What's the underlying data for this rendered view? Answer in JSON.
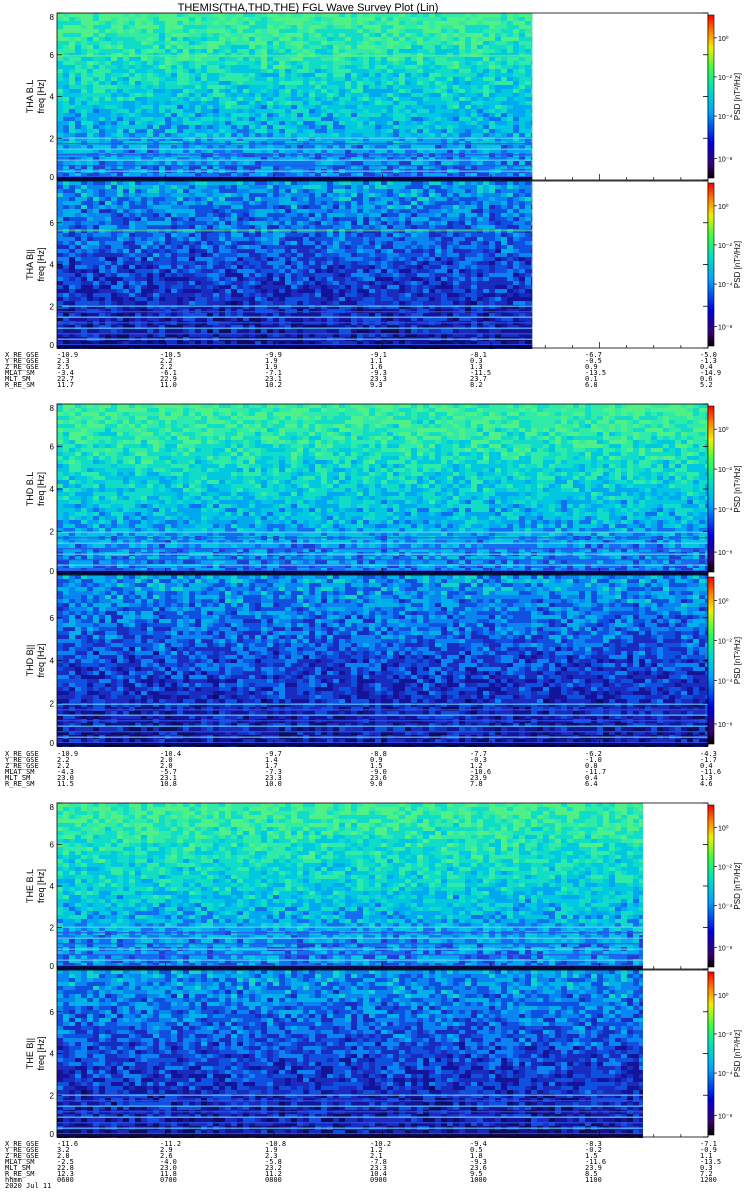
{
  "title": "THEMIS(THA,THD,THE) FGL Wave Survey Plot (Lin)",
  "ytitle_unit": "freq [Hz]",
  "ctitle": "PSD [nT²/Hz]",
  "cbar_ticks": [
    "10⁻⁸",
    "10⁻⁴",
    "10⁻²",
    "10⁰"
  ],
  "cbar_ticks_thd_bii": [
    "10⁻⁸",
    "10⁻⁴",
    "10⁻²",
    "10⁰"
  ],
  "colors": {
    "background_spec": "#1e2db4",
    "low_band": "#102090",
    "mid": "#00b4e6",
    "high": "#20e0c0",
    "top": "#40f090"
  },
  "chart_data": [
    {
      "type": "heatmap",
      "probe": "tha",
      "panels": [
        {
          "name": "THA B.L",
          "ylabel": "THA B.L",
          "ylim": [
            0,
            8
          ],
          "yticks": [
            "0",
            "2",
            "4",
            "6",
            "8"
          ],
          "data_end_fraction": 0.73,
          "tone": "bright"
        },
        {
          "name": "THA B||",
          "ylabel": "THA B||",
          "ylim": [
            0,
            8
          ],
          "yticks": [
            "0",
            "2",
            "4",
            "6"
          ],
          "data_end_fraction": 0.73,
          "tone": "dark"
        }
      ],
      "ephemeris": {
        "labels": [
          "X_RE_GSE",
          "Y_RE_GSE",
          "Z_RE_GSE",
          "MLAT_SM",
          "MLT_SM",
          "R_RE_SM"
        ],
        "columns": [
          [
            "-10.9",
            "2.3",
            "2.5",
            "-3.4",
            "22.7",
            "11.7"
          ],
          [
            "-10.5",
            "2.2",
            "2.2",
            "-6.1",
            "22.9",
            "11.0"
          ],
          [
            "-9.9",
            "1.9",
            "1.9",
            "-7.1",
            "23.1",
            "10.2"
          ],
          [
            "-9.1",
            "1.1",
            "1.6",
            "-9.3",
            "23.3",
            "9.3"
          ],
          [
            "-8.1",
            "0.3",
            "1.3",
            "-11.5",
            "23.7",
            "8.2"
          ],
          [
            "-6.7",
            "-0.5",
            "0.9",
            "-13.5",
            "0.1",
            "6.8"
          ],
          [
            "-5.0",
            "-1.3",
            "0.4",
            "-14.9",
            "0.6",
            "5.2"
          ]
        ]
      }
    },
    {
      "type": "heatmap",
      "probe": "thd",
      "panels": [
        {
          "name": "THD B.L",
          "ylabel": "THD B.L",
          "ylim": [
            0,
            8
          ],
          "yticks": [
            "0",
            "2",
            "4",
            "6",
            "8"
          ],
          "data_end_fraction": 1.0,
          "tone": "bright"
        },
        {
          "name": "THD B||",
          "ylabel": "THD B||",
          "ylim": [
            0,
            8
          ],
          "yticks": [
            "0",
            "2",
            "4",
            "6"
          ],
          "data_end_fraction": 1.0,
          "tone": "dark"
        }
      ],
      "ephemeris": {
        "labels": [
          "X_RE_GSE",
          "Y_RE_GSE",
          "Z_RE_GSE",
          "MLAT_SM",
          "MLT_SM",
          "R_RE_SM"
        ],
        "columns": [
          [
            "-10.9",
            "2.2",
            "2.2",
            "-4.3",
            "23.0",
            "11.5"
          ],
          [
            "-10.4",
            "2.0",
            "2.0",
            "-5.7",
            "23.1",
            "10.8"
          ],
          [
            "-9.7",
            "1.4",
            "1.7",
            "-7.3",
            "23.3",
            "10.0"
          ],
          [
            "-8.8",
            "0.9",
            "1.5",
            "-9.0",
            "23.6",
            "9.0"
          ],
          [
            "-7.7",
            "-0.3",
            "1.2",
            "-10.6",
            "23.9",
            "7.8"
          ],
          [
            "-6.2",
            "-1.0",
            "0.8",
            "-11.7",
            "0.4",
            "6.4"
          ],
          [
            "-4.3",
            "-1.7",
            "0.4",
            "-11.6",
            "1.3",
            "4.6"
          ]
        ]
      }
    },
    {
      "type": "heatmap",
      "probe": "the",
      "panels": [
        {
          "name": "THE B.L",
          "ylabel": "THE B.L",
          "ylim": [
            0,
            8
          ],
          "yticks": [
            "0",
            "2",
            "4",
            "6",
            "8"
          ],
          "data_end_fraction": 0.9,
          "tone": "bright"
        },
        {
          "name": "THE B||",
          "ylabel": "THE B||",
          "ylim": [
            0,
            8
          ],
          "yticks": [
            "0",
            "2",
            "4",
            "6"
          ],
          "data_end_fraction": 0.9,
          "tone": "dark"
        }
      ],
      "ephemeris": {
        "labels": [
          "X_RE_GSE",
          "Y_RE_GSE",
          "Z_RE_GSE",
          "MLAT_SM",
          "MLT_SM",
          "R_RE_SM",
          "hhmm",
          "2020 Jul 11"
        ],
        "columns": [
          [
            "-11.6",
            "3.2",
            "2.8",
            "-2.5",
            "22.8",
            "12.3",
            "0600"
          ],
          [
            "-11.2",
            "2.9",
            "2.6",
            "-4.0",
            "23.0",
            "11.8",
            "0700"
          ],
          [
            "-10.8",
            "1.9",
            "2.3",
            "-5.8",
            "23.2",
            "11.2",
            "0800"
          ],
          [
            "-10.2",
            "1.2",
            "2.1",
            "-7.8",
            "23.3",
            "10.4",
            "0900"
          ],
          [
            "-9.4",
            "0.5",
            "1.8",
            "-9.3",
            "23.6",
            "9.5",
            "1000"
          ],
          [
            "-8.3",
            "-0.2",
            "1.5",
            "-11.6",
            "23.9",
            "8.5",
            "1100"
          ],
          [
            "-7.1",
            "-0.9",
            "1.1",
            "-13.5",
            "0.3",
            "7.2",
            "1200"
          ]
        ]
      }
    }
  ]
}
